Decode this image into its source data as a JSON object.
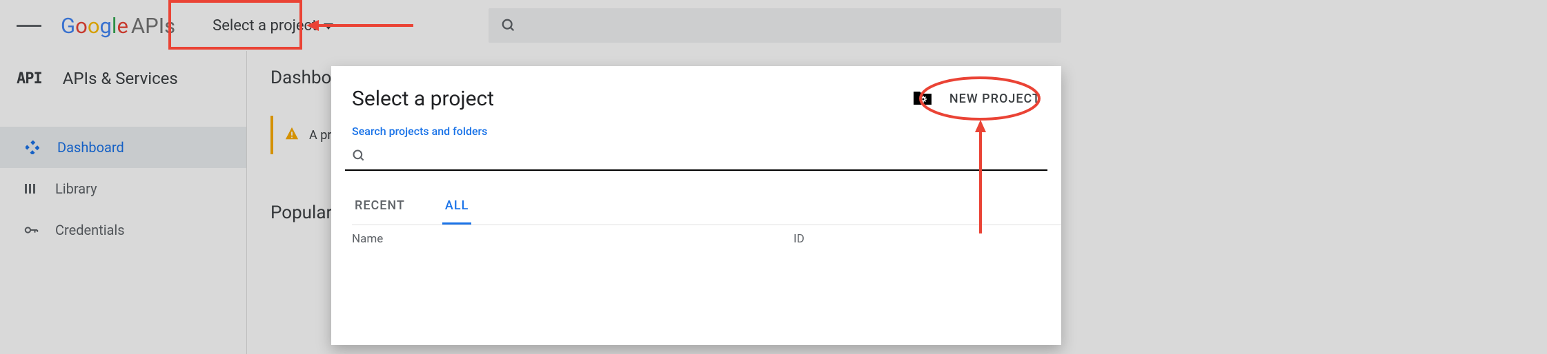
{
  "header": {
    "logo_text": "Google",
    "logo_suffix": "APIs",
    "project_selector_label": "Select a project"
  },
  "sidebar": {
    "title": "APIs & Services",
    "items": [
      {
        "label": "Dashboard",
        "icon": "diamonds-icon",
        "active": true
      },
      {
        "label": "Library",
        "icon": "library-icon",
        "active": false
      },
      {
        "label": "Credentials",
        "icon": "key-icon",
        "active": false
      }
    ]
  },
  "main": {
    "title": "Dashboard",
    "warning_prefix": "A proj",
    "popular_heading": "Popular APIs"
  },
  "dialog": {
    "title": "Select a project",
    "new_project_label": "NEW PROJECT",
    "search_label": "Search projects and folders",
    "search_placeholder": "",
    "tabs": [
      {
        "label": "RECENT",
        "active": false
      },
      {
        "label": "ALL",
        "active": true
      }
    ],
    "columns": {
      "name": "Name",
      "id": "ID"
    }
  }
}
